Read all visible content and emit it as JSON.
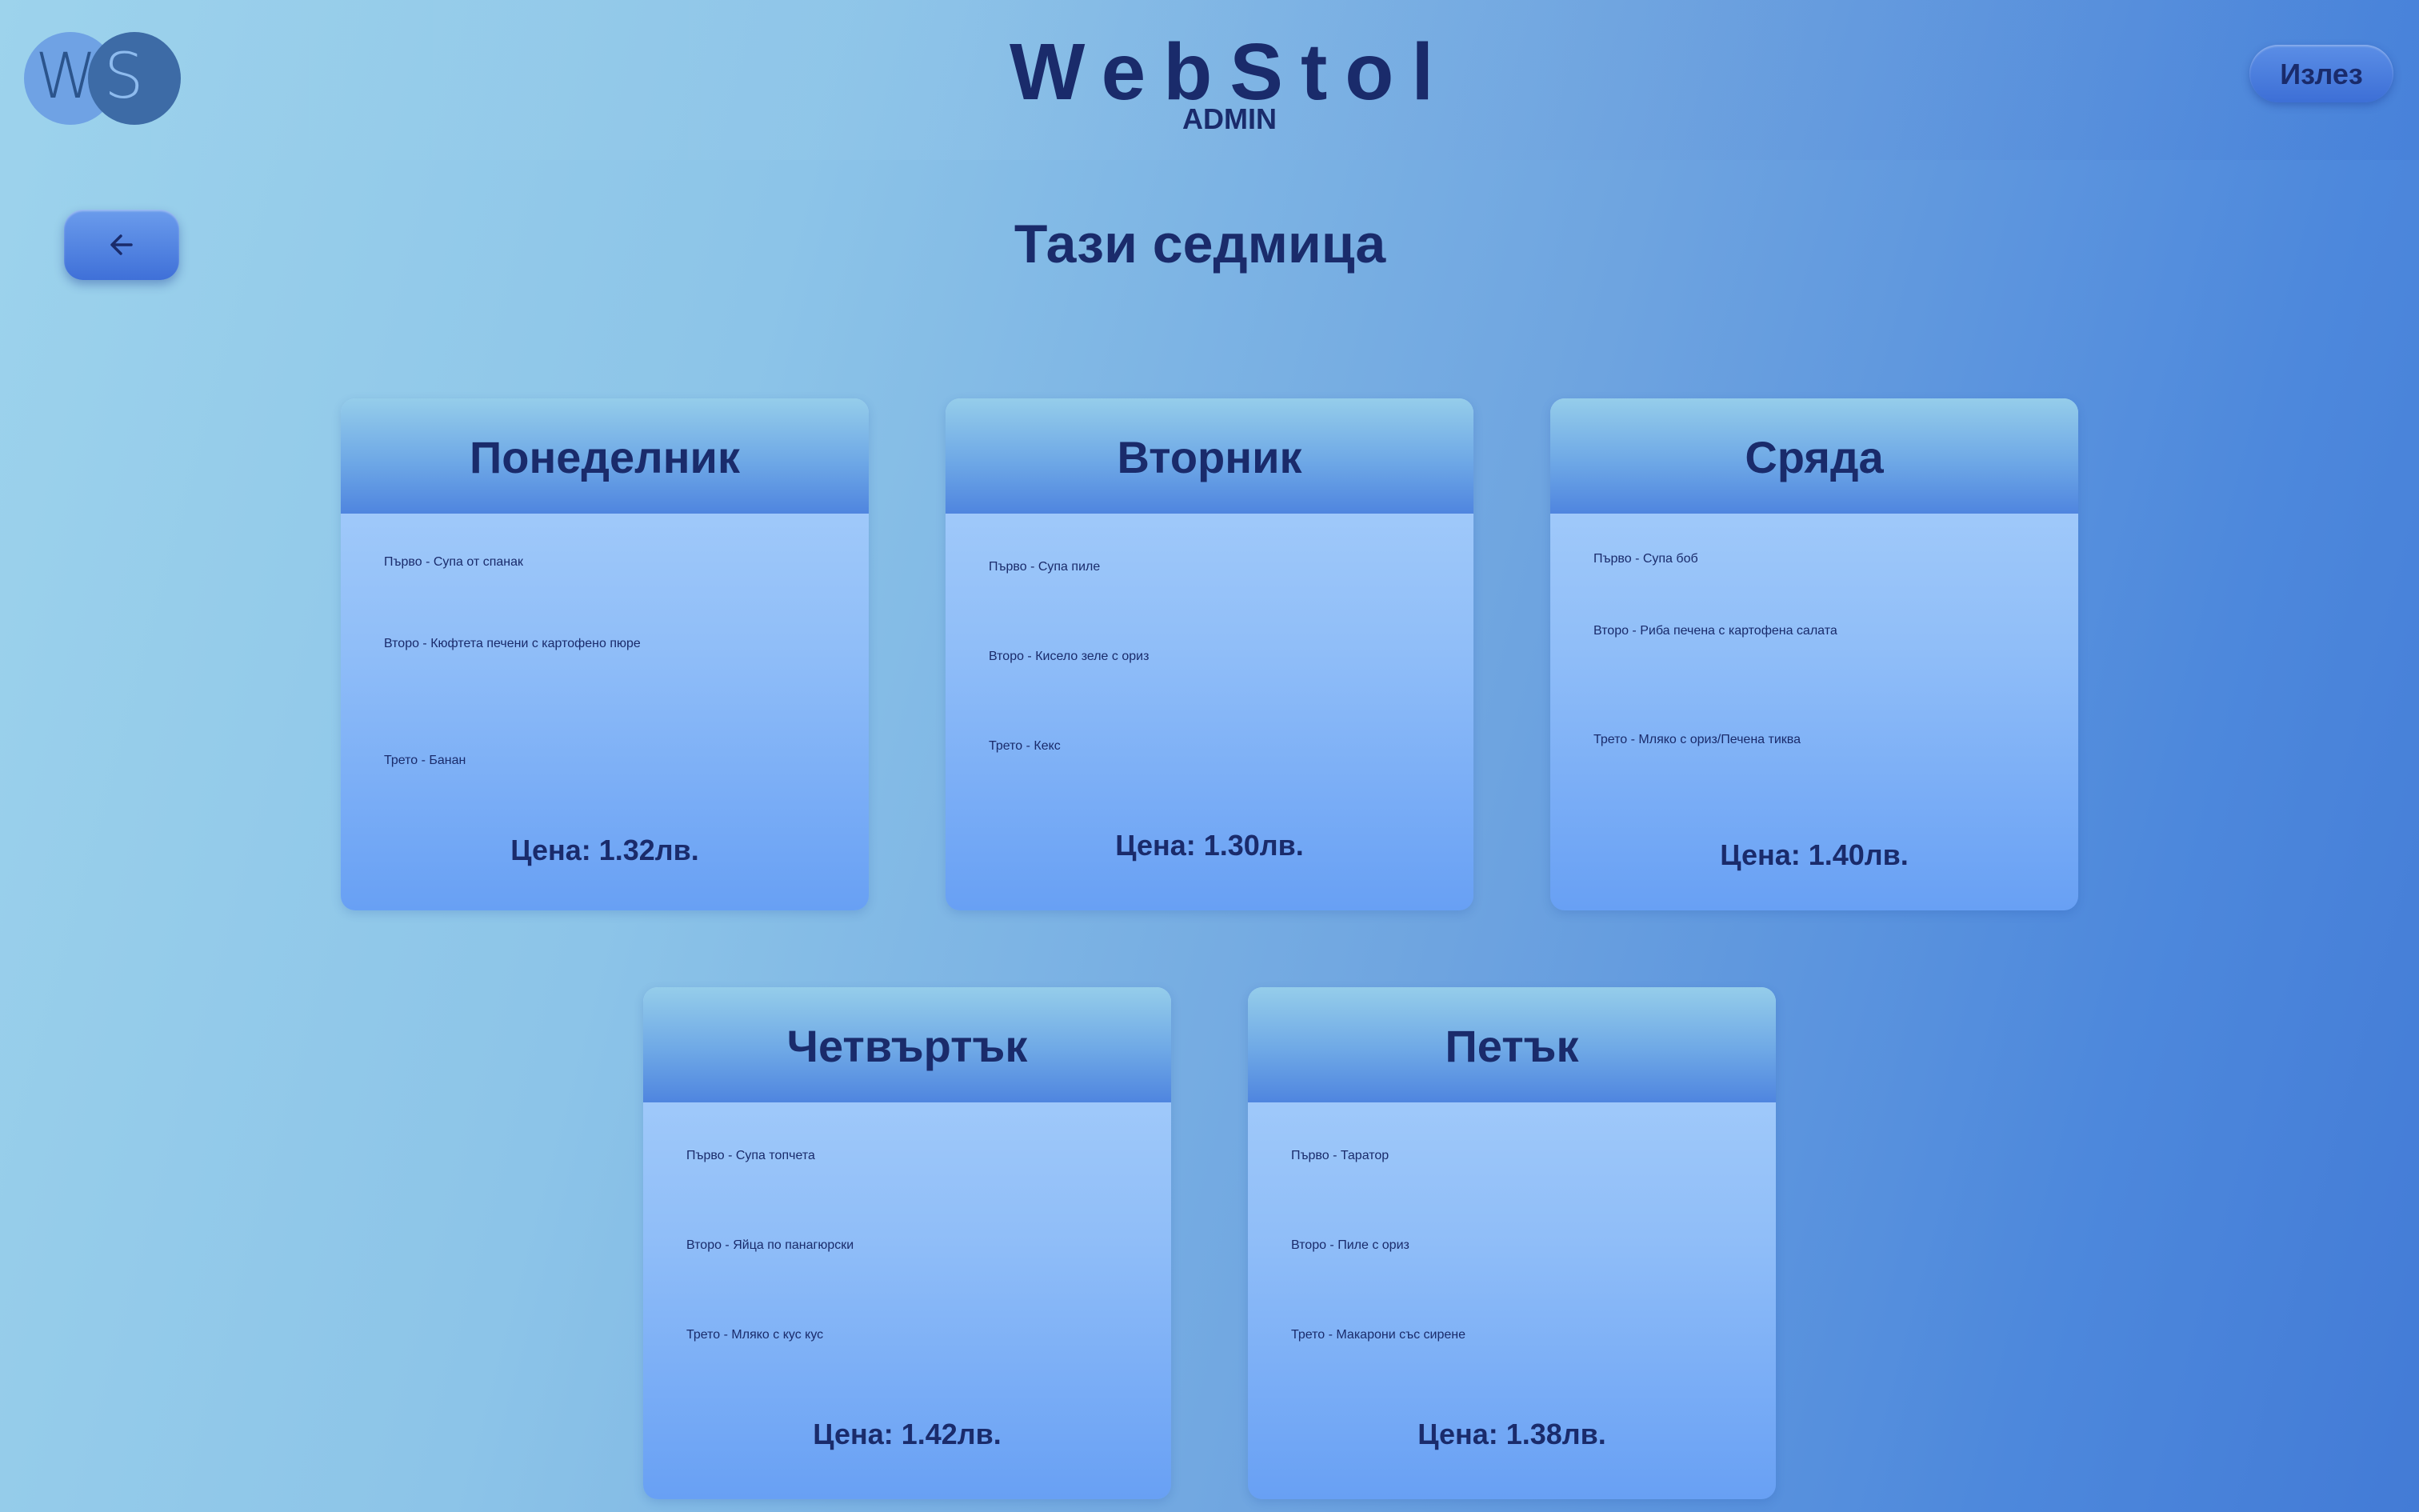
{
  "header": {
    "logo_left_letter": "W",
    "logo_right_letter": "S",
    "brand": "WebStol",
    "role": "ADMIN",
    "logout_label": "Излез"
  },
  "nav": {
    "back_icon": "arrow-left-icon"
  },
  "page_title": "Тази седмица",
  "days": [
    {
      "name": "Понеделник",
      "first": "Първо - Супа от спанак",
      "second": "Второ - Кюфтета печени с картофено пюре",
      "third": "Трето - Банан",
      "price": "Цена: 1.32лв."
    },
    {
      "name": "Вторник",
      "first": "Първо - Супа пиле",
      "second": "Второ - Кисело зеле с ориз",
      "third": "Трето - Кекс",
      "price": "Цена: 1.30лв."
    },
    {
      "name": "Сряда",
      "first": "Първо - Супа боб",
      "second": "Второ - Риба печена с картофена салата",
      "third": "Трето - Мляко с ориз/Печена тиква",
      "price": "Цена: 1.40лв."
    },
    {
      "name": "Четвъртък",
      "first": "Първо - Супа топчета",
      "second": "Второ - Яйца по панагюрски",
      "third": "Трето - Мляко с кус кус",
      "price": "Цена: 1.42лв."
    },
    {
      "name": "Петък",
      "first": "Първо - Таратор",
      "second": "Второ - Пиле с ориз",
      "third": "Трето - Макарони със сирене",
      "price": "Цена: 1.38лв."
    }
  ]
}
